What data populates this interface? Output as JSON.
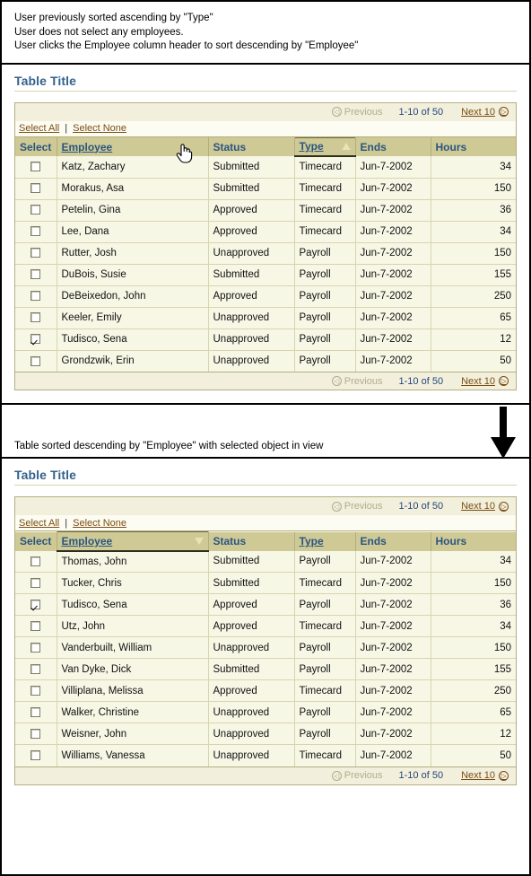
{
  "colors": {
    "header_bg": "#cfc995",
    "row_bg": "#f7f7e6",
    "pager_bg": "#f2f0dc",
    "title_text": "#33628c",
    "link_brown": "#7a4d12",
    "count_blue": "#25457a"
  },
  "top_caption": {
    "lines": [
      "User previously sorted ascending by \"Type\"",
      "User does not select any employees.",
      "User clicks the Employee column header to sort descending by \"Employee\""
    ]
  },
  "divider": {
    "caption": "Table sorted descending by \"Employee\" with selected object in view",
    "arrow_icon": "down-arrow-icon"
  },
  "pager": {
    "previous_label": "Previous",
    "previous_icon": "circle-left-arrow-icon",
    "range_label": "1-10 of 50",
    "next_label": "Next 10",
    "next_icon": "circle-right-arrow-icon"
  },
  "select_strip": {
    "select_all_label": "Select All",
    "separator": "|",
    "select_none_label": "Select None"
  },
  "columns": {
    "select": "Select",
    "employee": "Employee",
    "status": "Status",
    "type": "Type",
    "ends": "Ends",
    "hours": "Hours"
  },
  "table_one": {
    "title": "Table Title",
    "sorted_column": "Type",
    "sort_direction": "ascending",
    "sort_icon": "triangle-up-icon",
    "cursor_icon": "hand-pointer-cursor",
    "rows": [
      {
        "checked": false,
        "employee": "Katz, Zachary",
        "status": "Submitted",
        "type": "Timecard",
        "ends": "Jun-7-2002",
        "hours": "34"
      },
      {
        "checked": false,
        "employee": "Morakus, Asa",
        "status": "Submitted",
        "type": "Timecard",
        "ends": "Jun-7-2002",
        "hours": "150"
      },
      {
        "checked": false,
        "employee": "Petelin, Gina",
        "status": "Approved",
        "type": "Timecard",
        "ends": "Jun-7-2002",
        "hours": "36"
      },
      {
        "checked": false,
        "employee": "Lee, Dana",
        "status": "Approved",
        "type": "Timecard",
        "ends": "Jun-7-2002",
        "hours": "34"
      },
      {
        "checked": false,
        "employee": "Rutter, Josh",
        "status": "Unapproved",
        "type": "Payroll",
        "ends": "Jun-7-2002",
        "hours": "150"
      },
      {
        "checked": false,
        "employee": "DuBois, Susie",
        "status": "Submitted",
        "type": "Payroll",
        "ends": "Jun-7-2002",
        "hours": "155"
      },
      {
        "checked": false,
        "employee": "DeBeixedon, John",
        "status": "Approved",
        "type": "Payroll",
        "ends": "Jun-7-2002",
        "hours": "250"
      },
      {
        "checked": false,
        "employee": "Keeler, Emily",
        "status": "Unapproved",
        "type": "Payroll",
        "ends": "Jun-7-2002",
        "hours": "65"
      },
      {
        "checked": true,
        "employee": "Tudisco, Sena",
        "status": "Unapproved",
        "type": "Payroll",
        "ends": "Jun-7-2002",
        "hours": "12"
      },
      {
        "checked": false,
        "employee": "Grondzwik, Erin",
        "status": "Unapproved",
        "type": "Payroll",
        "ends": "Jun-7-2002",
        "hours": "50"
      }
    ]
  },
  "table_two": {
    "title": "Table Title",
    "sorted_column": "Employee",
    "sort_direction": "descending",
    "sort_icon": "triangle-down-icon",
    "rows": [
      {
        "checked": false,
        "employee": "Thomas, John",
        "status": "Submitted",
        "type": "Payroll",
        "ends": "Jun-7-2002",
        "hours": "34"
      },
      {
        "checked": false,
        "employee": "Tucker, Chris",
        "status": "Submitted",
        "type": "Timecard",
        "ends": "Jun-7-2002",
        "hours": "150"
      },
      {
        "checked": true,
        "employee": "Tudisco, Sena",
        "status": "Approved",
        "type": "Payroll",
        "ends": "Jun-7-2002",
        "hours": "36"
      },
      {
        "checked": false,
        "employee": "Utz, John",
        "status": "Approved",
        "type": "Timecard",
        "ends": "Jun-7-2002",
        "hours": "34"
      },
      {
        "checked": false,
        "employee": "Vanderbuilt, William",
        "status": "Unapproved",
        "type": "Payroll",
        "ends": "Jun-7-2002",
        "hours": "150"
      },
      {
        "checked": false,
        "employee": "Van Dyke, Dick",
        "status": "Submitted",
        "type": "Payroll",
        "ends": "Jun-7-2002",
        "hours": "155"
      },
      {
        "checked": false,
        "employee": "Villiplana, Melissa",
        "status": "Approved",
        "type": "Timecard",
        "ends": "Jun-7-2002",
        "hours": "250"
      },
      {
        "checked": false,
        "employee": "Walker, Christine",
        "status": "Unapproved",
        "type": "Payroll",
        "ends": "Jun-7-2002",
        "hours": "65"
      },
      {
        "checked": false,
        "employee": "Weisner, John",
        "status": "Unapproved",
        "type": "Payroll",
        "ends": "Jun-7-2002",
        "hours": "12"
      },
      {
        "checked": false,
        "employee": "Williams, Vanessa",
        "status": "Unapproved",
        "type": "Timecard",
        "ends": "Jun-7-2002",
        "hours": "50"
      }
    ]
  }
}
